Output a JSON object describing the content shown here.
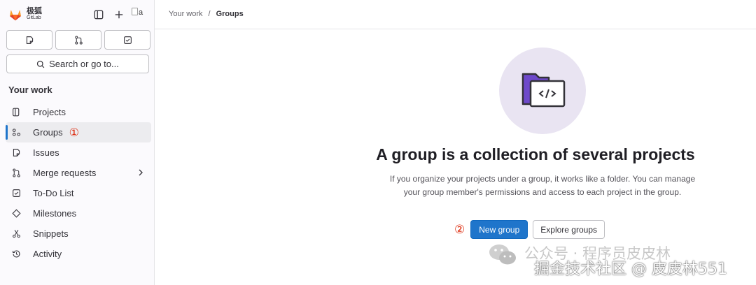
{
  "brand": {
    "name_zh": "极狐",
    "name_en": "GitLab",
    "avatar_alt": "a"
  },
  "sidebar": {
    "search_label": "Search or go to...",
    "section_title": "Your work",
    "items": [
      {
        "label": "Projects",
        "icon": "project-icon"
      },
      {
        "label": "Groups",
        "icon": "group-icon",
        "active": true,
        "marker": "①"
      },
      {
        "label": "Issues",
        "icon": "issues-icon"
      },
      {
        "label": "Merge requests",
        "icon": "merge-request-icon",
        "has_chevron": true
      },
      {
        "label": "To-Do List",
        "icon": "todo-icon"
      },
      {
        "label": "Milestones",
        "icon": "milestone-icon"
      },
      {
        "label": "Snippets",
        "icon": "snippet-icon"
      },
      {
        "label": "Activity",
        "icon": "history-icon"
      }
    ]
  },
  "breadcrumb": {
    "root": "Your work",
    "separator": "/",
    "current": "Groups"
  },
  "empty_state": {
    "title": "A group is a collection of several projects",
    "description": "If you organize your projects under a group, it works like a folder. You can manage your group member's permissions and access to each project in the group.",
    "marker": "②",
    "primary_button": "New group",
    "secondary_button": "Explore groups"
  },
  "watermark": {
    "line1": "公众号 · 程序员皮皮林",
    "line2": "掘金技术社区 @ 皮皮林551"
  },
  "colors": {
    "accent": "#1f75cb",
    "marker": "#dd2b0e",
    "illustration_bg": "#e9e4f2",
    "folder": "#6e49cb"
  }
}
